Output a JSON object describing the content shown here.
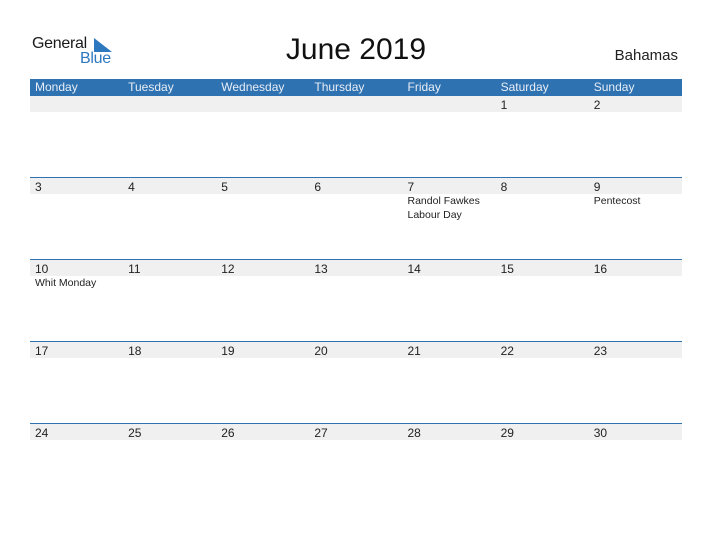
{
  "logo": {
    "word1": "General",
    "word2": "Blue",
    "icon": "triangle-flag-icon"
  },
  "title": "June 2019",
  "country": "Bahamas",
  "colors": {
    "header_bg": "#2e72b2",
    "date_strip": "#f0f0f0",
    "logo_blue": "#2e78c0"
  },
  "weekdays": [
    "Monday",
    "Tuesday",
    "Wednesday",
    "Thursday",
    "Friday",
    "Saturday",
    "Sunday"
  ],
  "weeks": [
    {
      "days": [
        "",
        "",
        "",
        "",
        "",
        "1",
        "2"
      ],
      "events": [
        [],
        [],
        [],
        [],
        [],
        [],
        []
      ]
    },
    {
      "days": [
        "3",
        "4",
        "5",
        "6",
        "7",
        "8",
        "9"
      ],
      "events": [
        [],
        [],
        [],
        [],
        [
          "Randol Fawkes",
          "Labour Day"
        ],
        [],
        [
          "Pentecost"
        ]
      ]
    },
    {
      "days": [
        "10",
        "11",
        "12",
        "13",
        "14",
        "15",
        "16"
      ],
      "events": [
        [
          "Whit Monday"
        ],
        [],
        [],
        [],
        [],
        [],
        []
      ]
    },
    {
      "days": [
        "17",
        "18",
        "19",
        "20",
        "21",
        "22",
        "23"
      ],
      "events": [
        [],
        [],
        [],
        [],
        [],
        [],
        []
      ]
    },
    {
      "days": [
        "24",
        "25",
        "26",
        "27",
        "28",
        "29",
        "30"
      ],
      "events": [
        [],
        [],
        [],
        [],
        [],
        [],
        []
      ]
    }
  ]
}
